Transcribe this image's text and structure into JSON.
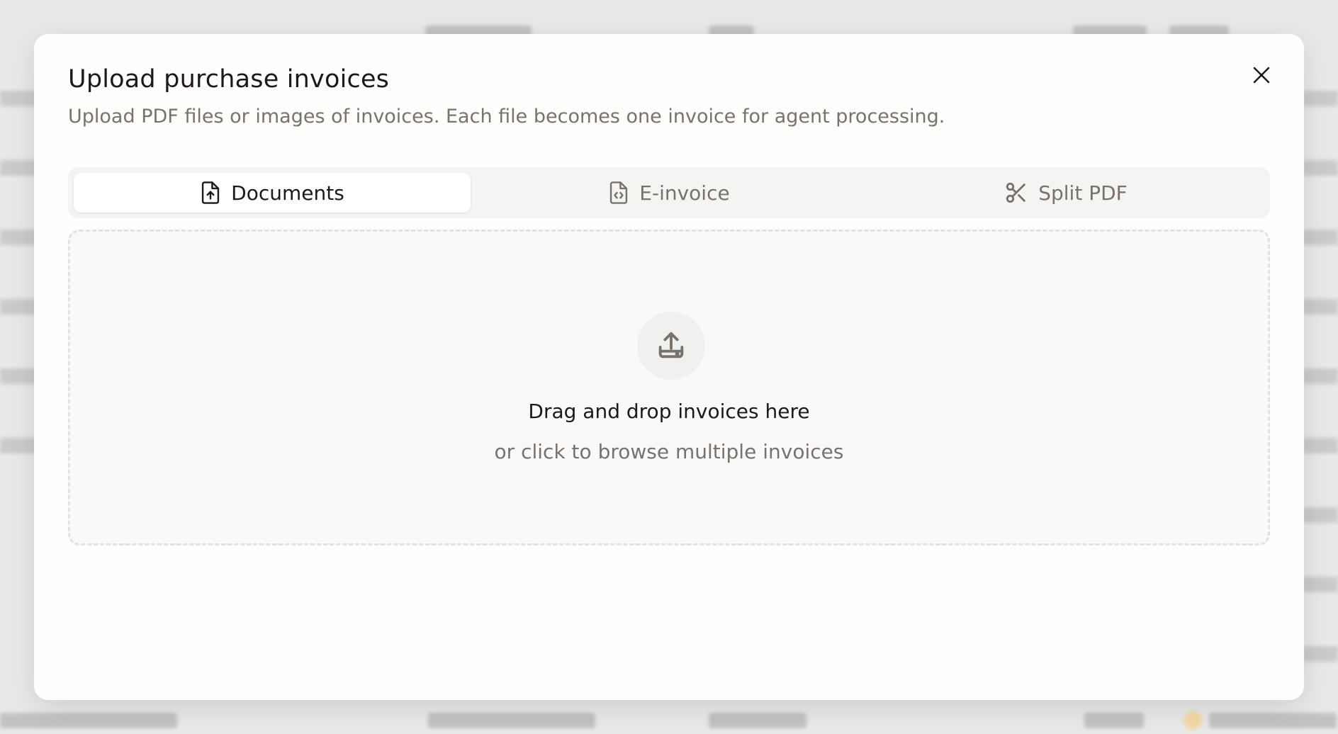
{
  "modal": {
    "title": "Upload purchase invoices",
    "subtitle": "Upload PDF files or images of invoices. Each file becomes one invoice for agent processing."
  },
  "tabs": [
    {
      "label": "Documents",
      "icon": "file-upload-icon",
      "active": true
    },
    {
      "label": "E-invoice",
      "icon": "file-code-icon",
      "active": false
    },
    {
      "label": "Split PDF",
      "icon": "scissors-icon",
      "active": false
    }
  ],
  "dropzone": {
    "title": "Drag and drop invoices here",
    "subtitle": "or click to browse multiple invoices",
    "icon": "upload-icon"
  },
  "colors": {
    "modal_bg": "#fefefd",
    "text_primary": "#1c1917",
    "text_muted": "#78716c",
    "tab_bar_bg": "#f4f4f3",
    "dropzone_border": "#e2e2e0"
  }
}
